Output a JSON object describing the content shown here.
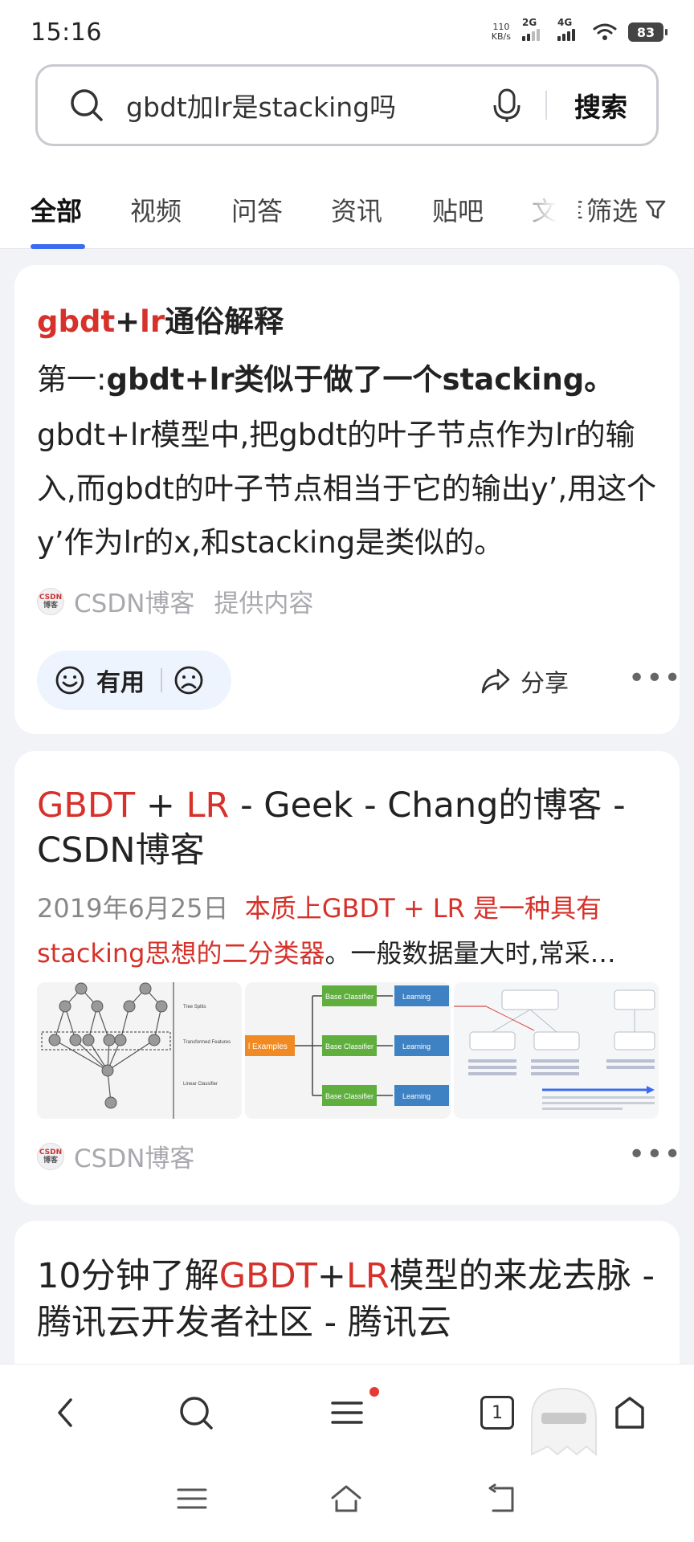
{
  "status": {
    "time": "15:16",
    "net_speed_value": "110",
    "net_speed_unit": "KB/s",
    "signal_1": "2G",
    "signal_2": "4G",
    "battery": "83"
  },
  "search": {
    "query": "gbdt加lr是stacking吗",
    "button": "搜索"
  },
  "tabs": {
    "items": [
      "全部",
      "视频",
      "问答",
      "资讯",
      "贴吧",
      "文库"
    ],
    "active": "全部",
    "filter_label": "筛选"
  },
  "answer_card": {
    "title_part1": "gbdt",
    "title_part2": "+",
    "title_part3": "lr",
    "title_part4": "通俗解释",
    "line1_prefix": "第一:",
    "line1_highlight": "gbdt+lr类似于做了一个stacking。",
    "body": "gbdt+lr模型中,把gbdt的叶子节点作为lr的输入,而gbdt的叶子节点相当于它的输出y’,用这个y’作为lr的x,和stacking是类似的。",
    "source": "CSDN博客",
    "source_suffix": "提供内容",
    "useful_label": "有用",
    "share_label": "分享"
  },
  "result2": {
    "title_part1": "GBDT",
    "title_part2": " + ",
    "title_part3": "LR",
    "title_part4": " - Geek - Chang的博客 - CSDN博客",
    "date": "2019年6月25日",
    "snippet_red": "本质上GBDT + LR 是一种具有stacking思想的二分类器",
    "snippet_rest": "。一般数据量大时,常采…",
    "source": "CSDN博客",
    "thumb1_labels": [
      "Tree Splits",
      "Transformed Features",
      "Linear Classifier"
    ],
    "thumb2_labels": [
      "l Examples",
      "Base Classifier",
      "Learning"
    ]
  },
  "result3": {
    "title_part1": "10分钟了解",
    "title_part2": "GBDT",
    "title_part3": "+",
    "title_part4": "LR",
    "title_part5": "模型的来龙去脉 - 腾讯云开发者社区 - 腾讯云"
  },
  "bottom_nav": {
    "tab_count": "1"
  },
  "colors": {
    "accent_blue": "#3a6cf0",
    "highlight_red": "#d6312a",
    "highlight_purple": "#e8d8f6"
  }
}
